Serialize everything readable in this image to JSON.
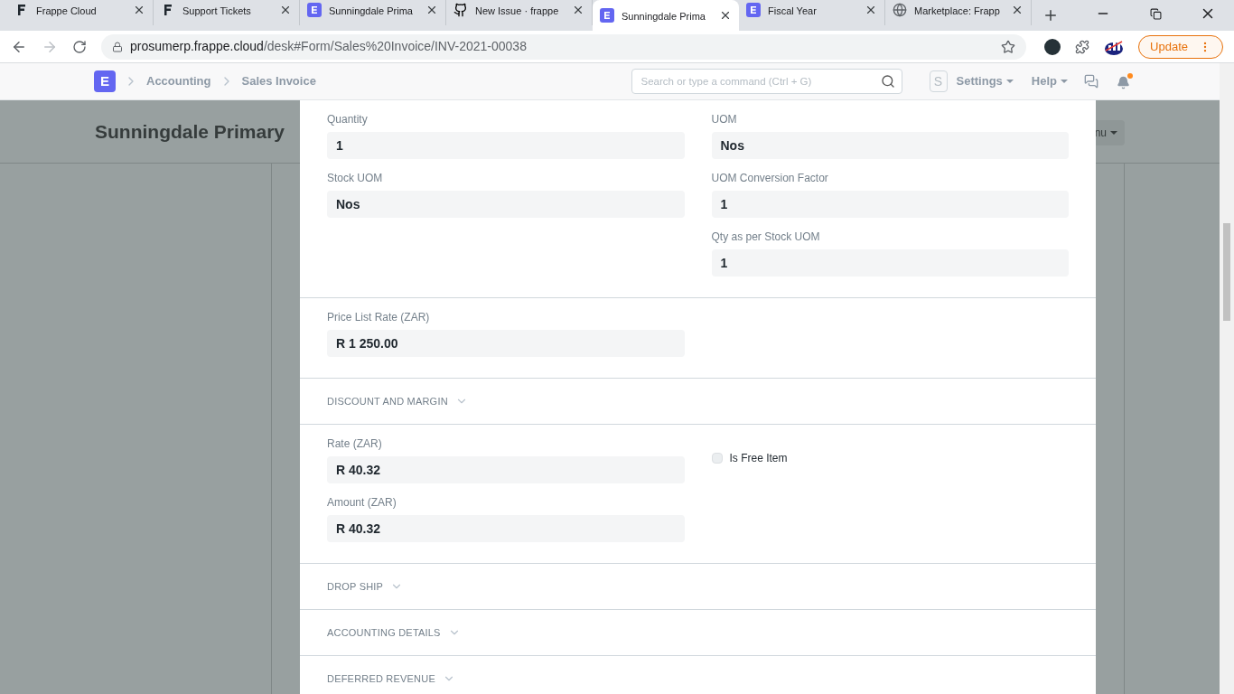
{
  "browser": {
    "tabs": [
      {
        "title": "Frappe Cloud",
        "kind": "frappe",
        "selected": false
      },
      {
        "title": "Support Tickets",
        "kind": "frappe",
        "selected": false
      },
      {
        "title": "Sunningdale Prima",
        "kind": "erp",
        "selected": false
      },
      {
        "title": "New Issue · frappe",
        "kind": "github",
        "selected": false
      },
      {
        "title": "Sunningdale Prima",
        "kind": "erp",
        "selected": true
      },
      {
        "title": "Fiscal Year",
        "kind": "erp",
        "selected": false
      },
      {
        "title": "Marketplace: Frapp",
        "kind": "globe",
        "selected": false
      }
    ],
    "address": {
      "host": "prosumerp.frappe.cloud",
      "path": "/desk#Form/Sales%20Invoice/INV-2021-00038"
    },
    "update_button": "Update"
  },
  "navbar": {
    "logo": "E",
    "breadcrumbs": [
      "Accounting",
      "Sales Invoice"
    ],
    "search": {
      "placeholder": "Search or type a command (Ctrl + G)"
    },
    "avatar": "S",
    "menus": [
      "Settings",
      "Help"
    ],
    "notification_unread": true
  },
  "page": {
    "title": "Sunningdale Primary",
    "menu_button": "nu"
  },
  "dialog": {
    "sections": [
      {
        "kind": "fields",
        "columns": [
          [
            {
              "kind": "field",
              "label": "Quantity",
              "value": "1"
            },
            {
              "kind": "field",
              "label": "Stock UOM",
              "value": "Nos"
            }
          ],
          [
            {
              "kind": "field",
              "label": "UOM",
              "value": "Nos"
            },
            {
              "kind": "field",
              "label": "UOM Conversion Factor",
              "value": "1"
            },
            {
              "kind": "field",
              "label": "Qty as per Stock UOM",
              "value": "1"
            }
          ]
        ]
      },
      {
        "kind": "fields",
        "columns": [
          [
            {
              "kind": "field",
              "label": "Price List Rate (ZAR)",
              "value": "R 1 250.00"
            }
          ],
          []
        ]
      },
      {
        "kind": "collapsed",
        "title": "DISCOUNT AND MARGIN",
        "expanded": false
      },
      {
        "kind": "fields",
        "columns": [
          [
            {
              "kind": "field",
              "label": "Rate (ZAR)",
              "value": "R 40.32"
            },
            {
              "kind": "field",
              "label": "Amount (ZAR)",
              "value": "R 40.32"
            }
          ],
          [
            {
              "kind": "checkbox",
              "label": "Is Free Item",
              "checked": false
            }
          ]
        ]
      },
      {
        "kind": "collapsed",
        "title": "DROP SHIP",
        "expanded": false
      },
      {
        "kind": "collapsed",
        "title": "ACCOUNTING DETAILS",
        "expanded": false
      },
      {
        "kind": "collapsed",
        "title": "DEFERRED REVENUE",
        "expanded": false
      }
    ]
  }
}
